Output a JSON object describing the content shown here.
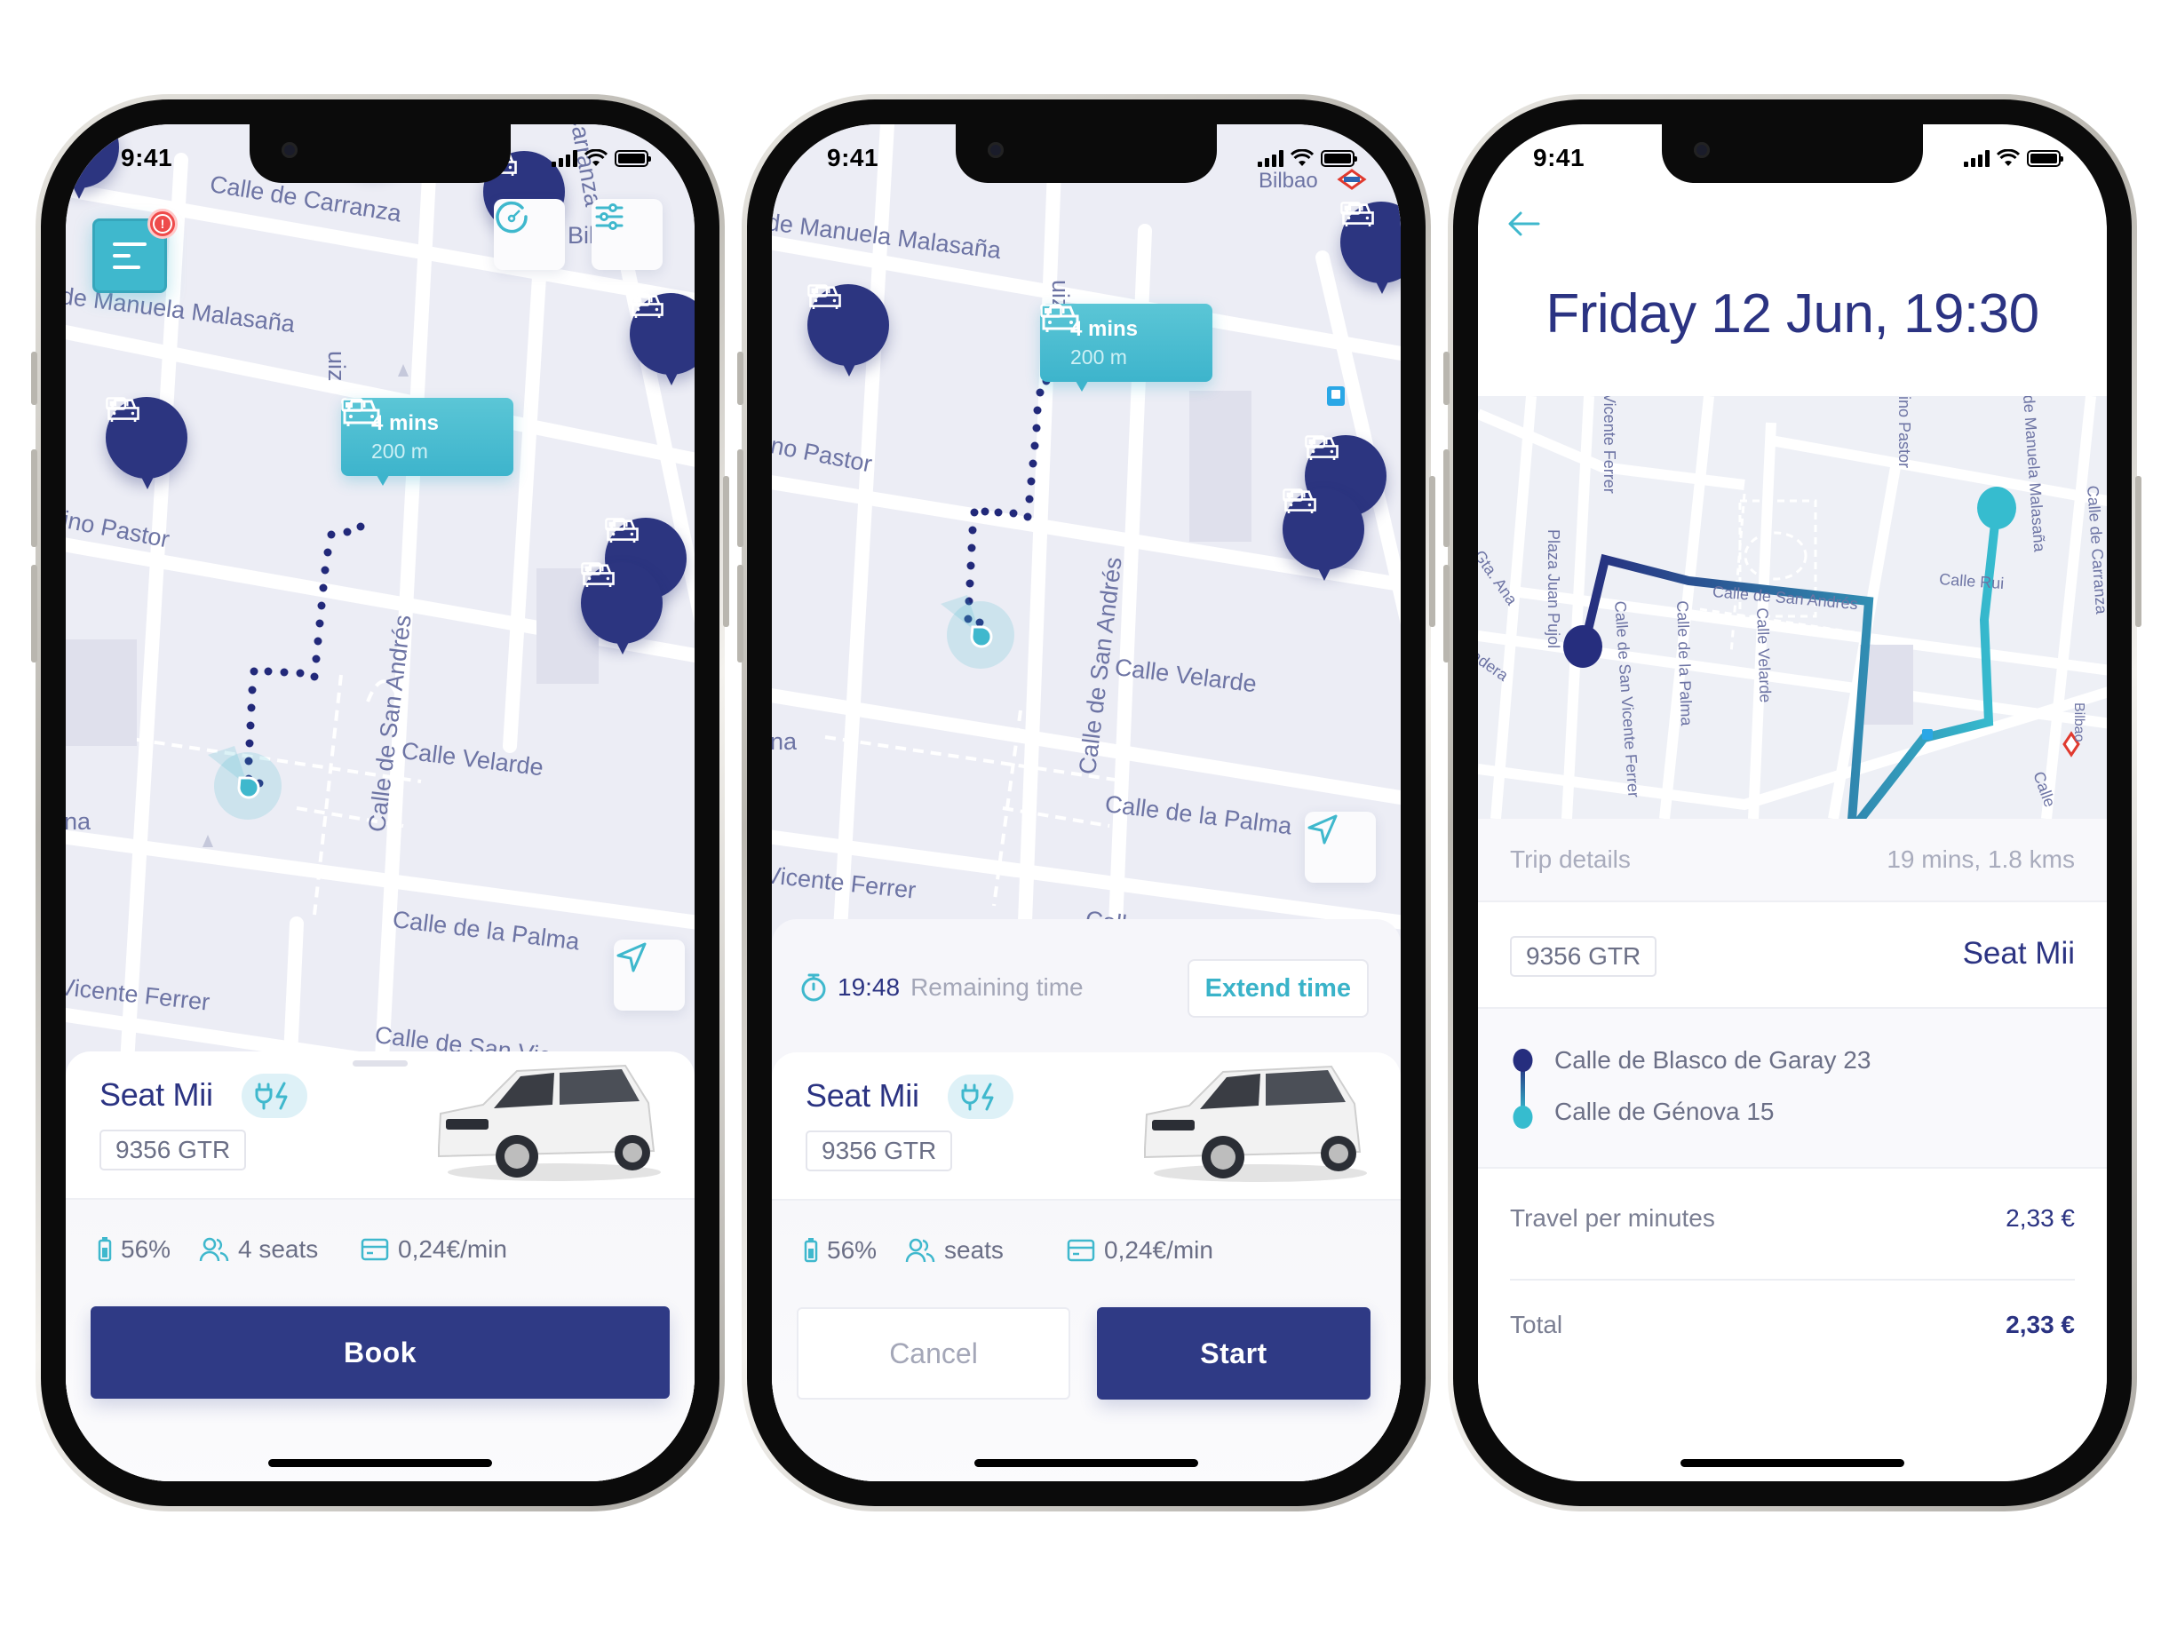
{
  "status_bar": {
    "time": "9:41"
  },
  "colors": {
    "navy": "#2c3580",
    "teal": "#3fb8cd",
    "alert": "#ee4b4b",
    "map_bg": "#ecedf5",
    "label": "#6d74a4"
  },
  "screen_map": {
    "menu_icon": "hamburger-menu-icon",
    "alert_badge": "!",
    "street_labels": [
      "Calle de Carranza",
      "de Manuela Malasaña",
      "ino Pastor",
      "Calle de San Andrés",
      "Calle Velarde",
      "Calle de la Palma",
      "Vicente Ferrer",
      "Calle de San Vicente Ferrer",
      "uiz",
      "Carranza",
      "Bilb",
      "na"
    ],
    "selected_car_bubble": {
      "eta": "4 mins",
      "distance": "200 m"
    },
    "car_card": {
      "model": "Seat Mii",
      "ev_badge_icon": "plug-lightning-icon",
      "plate": "9356 GTR",
      "battery": "56%",
      "seats": "4 seats",
      "price": "0,24€/min"
    },
    "book_label": "Book"
  },
  "screen_booked": {
    "street_labels": [
      "de Manuela Malasaña",
      "ino Pastor",
      "Calle de San Andrés",
      "Calle Velarde",
      "Calle de la Palma",
      "Vicente Ferrer",
      "uiz",
      "Bilbao",
      "na",
      "Calle"
    ],
    "selected_car_bubble": {
      "eta": "4 mins",
      "distance": "200 m"
    },
    "timer": {
      "value": "19:48",
      "label": "Remaining time",
      "extend_label": "Extend time"
    },
    "car_card": {
      "model": "Seat Mii",
      "plate": "9356 GTR",
      "battery": "56%",
      "seats": "seats",
      "price": "0,24€/min"
    },
    "cancel_label": "Cancel",
    "start_label": "Start"
  },
  "screen_trip": {
    "title": "Friday 12 Jun, 19:30",
    "map_labels": [
      "Vicente Ferrer",
      "Plaza Juan Pujol",
      "Calle de San Vicente Ferrer",
      "Calle de la Palma",
      "Calle Velarde",
      "Calle de San Andrés",
      "ino Pastor",
      "de Manuela Malasaña",
      "Calle Rui",
      "Calle de Carranza",
      "Bilbao",
      "Gta. Ana",
      "adera",
      "Calle"
    ],
    "trip_details_label": "Trip details",
    "trip_summary": "19 mins, 1.8 kms",
    "plate": "9356 GTR",
    "model": "Seat Mii",
    "origin": "Calle de Blasco de Garay 23",
    "destination": "Calle de Génova 15",
    "fare_rows": [
      {
        "label": "Travel per minutes",
        "value": "2,33 €"
      },
      {
        "label": "Total",
        "value": "2,33 €"
      }
    ]
  }
}
